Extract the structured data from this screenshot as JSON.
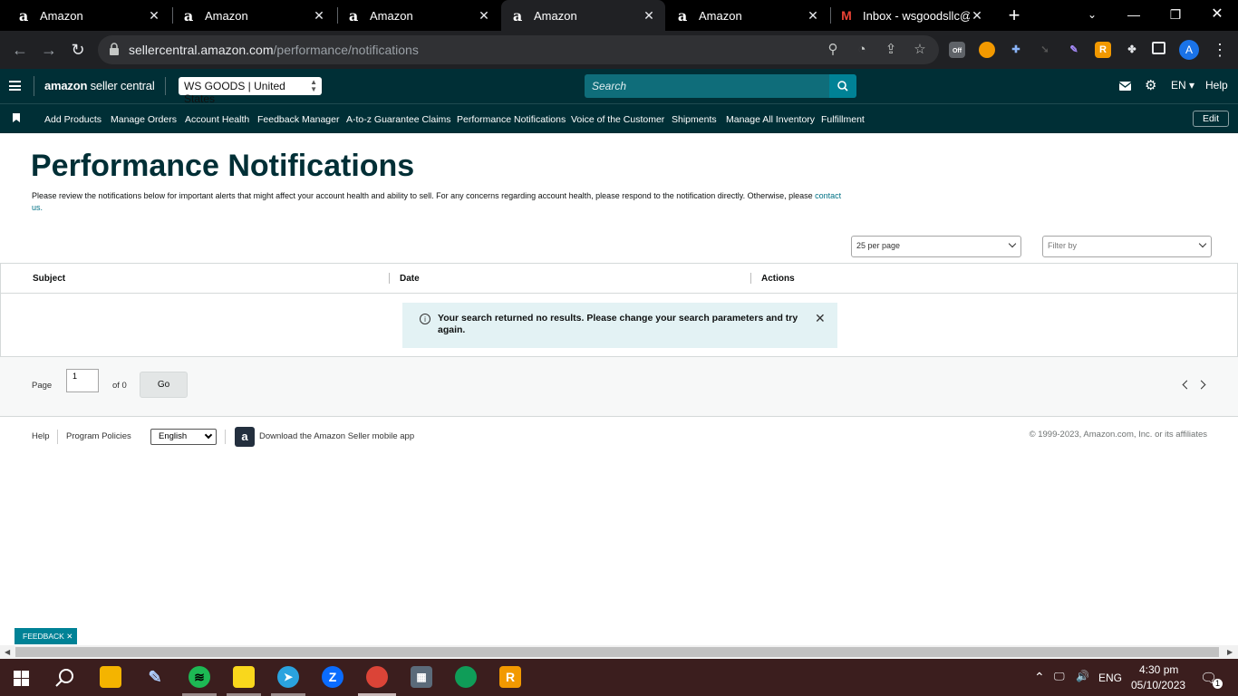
{
  "browser": {
    "tabs": [
      {
        "title": "Amazon",
        "favicon": "amazon-a"
      },
      {
        "title": "Amazon",
        "favicon": "amazon-a"
      },
      {
        "title": "Amazon",
        "favicon": "amazon-a"
      },
      {
        "title": "Amazon",
        "favicon": "amazon-a",
        "active": true
      },
      {
        "title": "Amazon",
        "favicon": "amazon-a"
      },
      {
        "title": "Inbox - wsgoodsllc@",
        "favicon": "gmail-m"
      }
    ],
    "url_host": "sellercentral.amazon.com",
    "url_path": "/performance/notifications",
    "profile_initial": "A",
    "ext_off_badge": "Off"
  },
  "header": {
    "logo_bold": "amazon",
    "logo_rest": " seller central",
    "store": "WS GOODS | United States",
    "search_placeholder": "Search",
    "language": "EN",
    "help": "Help"
  },
  "nav": {
    "items": [
      "Add Products",
      "Manage Orders",
      "Account Health",
      "Feedback Manager",
      "A-to-z Guarantee Claims",
      "Performance Notifications",
      "Voice of the Customer",
      "Shipments",
      "Manage All Inventory",
      "Fulfillment"
    ],
    "edit": "Edit"
  },
  "page": {
    "title": "Performance Notifications",
    "description": "Please review the notifications below for important alerts that might affect your account health and ability to sell. For any concerns regarding account health, please respond to the notification directly. Otherwise, please ",
    "contact_link": "contact us.",
    "per_page": "25 per page",
    "filter_placeholder": "Filter by",
    "columns": [
      "Subject",
      "Date",
      "Actions"
    ],
    "alert": "Your search returned no results. Please change your search parameters and try again.",
    "pager": {
      "page_label": "Page",
      "page_value": "1",
      "of_label": "of 0",
      "go": "Go"
    }
  },
  "footer": {
    "help": "Help",
    "program_policies": "Program Policies",
    "language": "English",
    "app_text": "Download the Amazon Seller mobile app",
    "copyright": "© 1999-2023, Amazon.com, Inc. or its affiliates"
  },
  "feedback": "FEEDBACK",
  "taskbar": {
    "lang": "ENG",
    "time": "4:30 pm",
    "date": "05/10/2023",
    "notif_count": "1"
  },
  "colors": {
    "header_bg": "#002f36",
    "accent": "#008296",
    "alert_bg": "#e3f2f4"
  }
}
